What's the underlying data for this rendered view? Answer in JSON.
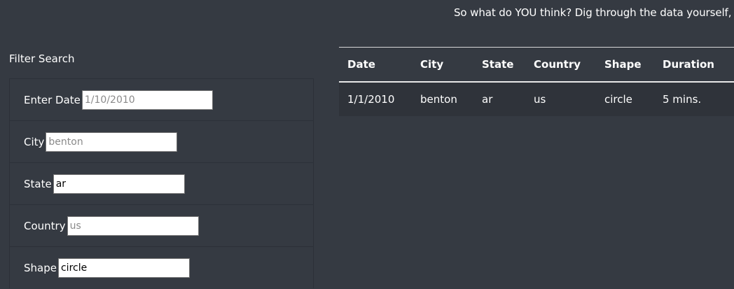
{
  "intro": {
    "text": "So what do YOU think? Dig through the data yourself, an"
  },
  "filter": {
    "heading": "Filter Search",
    "fields": [
      {
        "label": "Enter Date",
        "value": "",
        "placeholder": "1/10/2010"
      },
      {
        "label": "City",
        "value": "",
        "placeholder": "benton"
      },
      {
        "label": "State",
        "value": "ar",
        "placeholder": ""
      },
      {
        "label": "Country",
        "value": "",
        "placeholder": "us"
      },
      {
        "label": "Shape",
        "value": "circle",
        "placeholder": ""
      }
    ]
  },
  "table": {
    "columns": [
      "Date",
      "City",
      "State",
      "Country",
      "Shape",
      "Duration"
    ],
    "rows": [
      [
        "1/1/2010",
        "benton",
        "ar",
        "us",
        "circle",
        "5 mins."
      ]
    ]
  }
}
